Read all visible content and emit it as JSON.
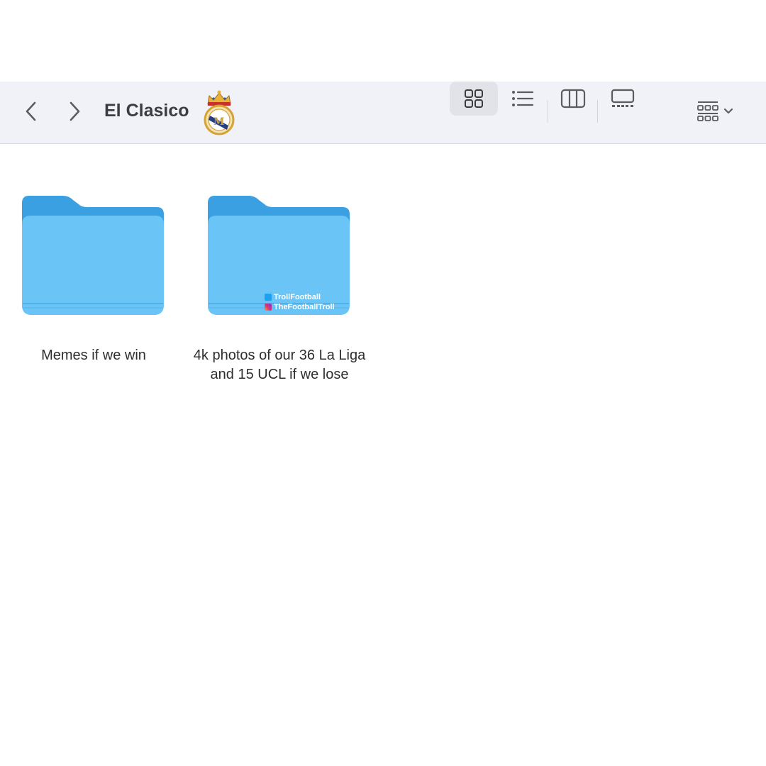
{
  "toolbar": {
    "title": "El Clasico",
    "nav": {
      "back_icon": "chevron-left-icon",
      "forward_icon": "chevron-right-icon"
    },
    "views": [
      {
        "name": "icon-view",
        "icon": "grid-icon",
        "active": true
      },
      {
        "name": "list-view",
        "icon": "list-icon",
        "active": false
      },
      {
        "name": "column-view",
        "icon": "columns-icon",
        "active": false
      },
      {
        "name": "gallery-view",
        "icon": "gallery-icon",
        "active": false
      }
    ],
    "group_icon": "group-by-icon"
  },
  "items": [
    {
      "type": "folder",
      "label": "Memes if we win"
    },
    {
      "type": "folder",
      "label": "4k photos of our 36 La Liga and 15 UCL if we lose"
    }
  ],
  "watermark": {
    "line1": "TrollFootball",
    "line2": "TheFootballTroll"
  },
  "colors": {
    "toolbar_bg": "#f1f2f7",
    "folder_back": "#3aa0e2",
    "folder_front": "#6ac5f6",
    "text": "#2e2e30"
  }
}
